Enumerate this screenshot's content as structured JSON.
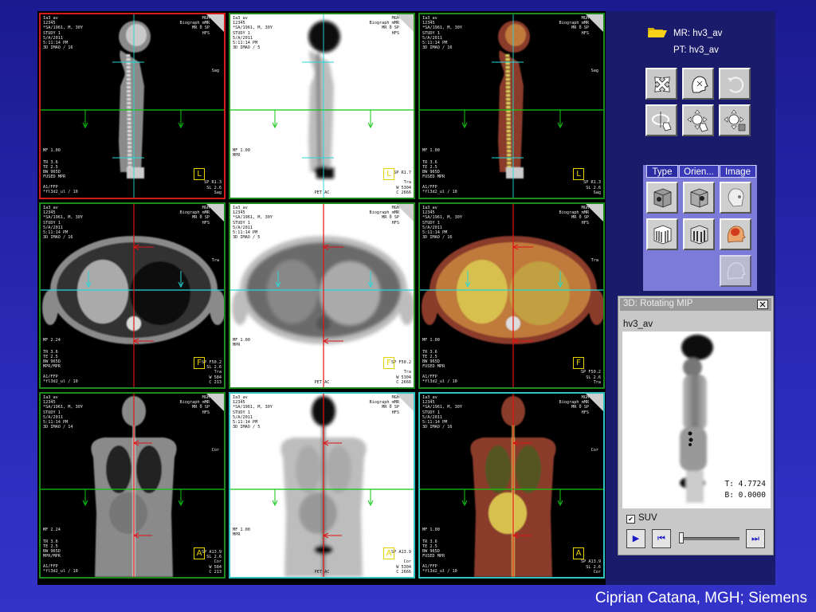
{
  "viewports": [
    {
      "id": "mr-sag",
      "tl": "Ia3_av\n12345\n*SA/1961, M, 30Y\nSTUDY 1\n5/A/2011\n5:11:14 PM\n3D IMAO / 16",
      "tr": "MGH\nBiograph_mMR\nMR 0 SP\nHFS",
      "plane": "Sag",
      "zoom": "MF 1.00",
      "bl": "TR 3.6\nTE 2.5\nBW 965D\nFUSED MPR\n\nA1/FFP\n*fl3d2_ul / 10",
      "br": "SP R1.3\nSL 2.6\nSag",
      "orient": "L",
      "bc": ""
    },
    {
      "id": "pet-sag",
      "tl": "Ia3_av\n12345\n*SA/1961, M, 30Y\nSTUDY 1\n5/A/2011\n5:11:14 PM\n3D IMAO / 5",
      "tr": "MGH\nBiograph_mMR\nMR 0 SP\nHFS",
      "plane": "",
      "zoom": "MF 1.00\nMPR",
      "bl": "",
      "br": "SP R1.7\n\nTra\nW 5304\nC 2666",
      "orient": "L",
      "bc": "PET AC"
    },
    {
      "id": "fused-sag",
      "tl": "Ia3_av\n12345\n*SA/1961, M, 30Y\nSTUDY 1\n5/A/2011\n5:11:14 PM\n3D IMAO / 16",
      "tr": "MGH\nBiograph_mMR\nMR 0 SP\nHFS",
      "plane": "Sag",
      "zoom": "MF 1.00",
      "bl": "TR 3.6\nTE 2.5\nBW 965D\nFUSED MPR\n\nA1/FFP\n*fl3d2_ul / 10",
      "br": "SP R1.3\nSL 2.6\nSag",
      "orient": "L",
      "bc": ""
    },
    {
      "id": "mr-tra",
      "tl": "Ia3_av\n12345\n*SA/1961, M, 30Y\nSTUDY 1\n5/A/2011\n5:11:14 PM\n3D IMAO / 16",
      "tr": "MGH\nBiograph_mMR\nMR 0 SP\nHFS",
      "plane": "Tra",
      "zoom": "MF 2.24",
      "bl": "TR 3.6\nTE 2.5\nBW 965D\nMPR/MPR\n\nA1/FFP\n*fl3d2_ul / 10",
      "br": "SP F50.2\nSL 2.6\nTra\nW 584\nC 213",
      "orient": "F",
      "bc": ""
    },
    {
      "id": "pet-tra",
      "tl": "Ia3_av\n12345\n*SA/1961, M, 30Y\nSTUDY 1\n5/A/2011\n5:11:14 PM\n3D IMAO / 5",
      "tr": "MGH\nBiograph_mMR\nMR 0 SP\nHFS",
      "plane": "",
      "zoom": "MF 1.00\nMPR",
      "bl": "",
      "br": "SP F50.2\n\nTra\nW 5304\nC 2666",
      "orient": "F",
      "bc": "PET AC"
    },
    {
      "id": "fused-tra",
      "tl": "Ia3_av\n12345\n*SA/1961, M, 30Y\nSTUDY 1\n5/A/2011\n5:11:14 PM\n3D IMAO / 16",
      "tr": "MGH\nBiograph_mMR\nMR 0 SP\nHFS",
      "plane": "Tra",
      "zoom": "MF 1.00",
      "bl": "TR 3.6\nTE 2.5\nBW 965D\nFUSED MPR\n\nA1/FFP\n*fl3d2_ul / 10",
      "br": "SP F50.2\nSL 2.6\nTra",
      "orient": "F",
      "bc": ""
    },
    {
      "id": "mr-cor",
      "tl": "Ia3_av\n12345\n*SA/1961, M, 30Y\nSTUDY 1\n5/A/2011\n5:11:14 PM\n3D IMAO / 14",
      "tr": "MGH\nBiograph_mMR\nMR 0 SP\nHFS",
      "plane": "Cor",
      "zoom": "MF 2.24",
      "bl": "TR 3.6\nTE 2.5\nBW 965D\nMPR/MPR\n\nA1/FFP\n*fl3d2_ul / 10",
      "br": "SP A13.9\nSL 2.6\nCor\nW 584\nC 213",
      "orient": "A",
      "bc": ""
    },
    {
      "id": "pet-cor",
      "tl": "Ia3_av\n12345\n*SA/1961, M, 30Y\nSTUDY 1\n5/A/2011\n5:11:14 PM\n3D IMAO / 5",
      "tr": "MGH\nBiograph_mMR\nMR 0 SP\nHFS",
      "plane": "",
      "zoom": "MF 1.00\nMPR",
      "bl": "",
      "br": "SP A13.9\n\nCor\nW 5304\nC 2666",
      "orient": "A",
      "bc": "PET AC"
    },
    {
      "id": "fused-cor",
      "tl": "Ia3_av\n12345\n*SA/1961, M, 30Y\nSTUDY 1\n5/A/2011\n5:11:14 PM\n3D IMAO / 16",
      "tr": "MGH\nBiograph_mMR\nMR 0 SP\nHFS",
      "plane": "Cor",
      "zoom": "MF 1.00",
      "bl": "TR 3.6\nTE 2.5\nBW 965D\nFUSED MPR\n\nA1/FFP\n*fl3d2_ul / 10",
      "br": "SP A13.9\nSL 2.6\nCor",
      "orient": "A",
      "bc": ""
    }
  ],
  "sidebar": {
    "mr_series": "MR: hv3_av",
    "pt_series": "PT: hv3_av",
    "tabs": [
      "Type",
      "Orien...",
      "Image"
    ]
  },
  "mip_window": {
    "title": "3D: Rotating MIP",
    "close": "✕",
    "series": "hv3_av",
    "t_value": "T: 4.7724",
    "b_value": "B: 0.0000",
    "suv_label": "SUV",
    "suv_check": "✔",
    "play": "▶",
    "step_back": "⏮",
    "step_fwd": "⏭"
  },
  "credit": "Ciprian Catana, MGH; Siemens",
  "colors": {
    "active_border": "#d21c1c",
    "viewport_border": "#1c8a1c",
    "crosshair_green": "#12c812",
    "crosshair_red": "#e01414",
    "crosshair_cyan": "#25d8d8"
  }
}
